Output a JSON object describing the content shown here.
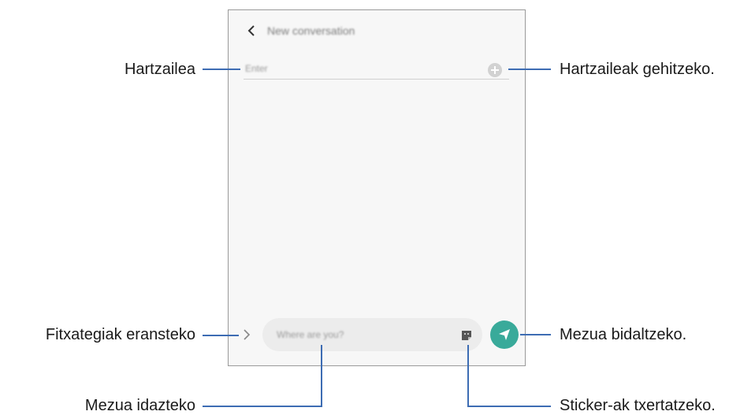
{
  "screen": {
    "title": "New conversation",
    "recipient_placeholder": "Enter",
    "message_placeholder": "Where are you?"
  },
  "callouts": {
    "recipient": "Hartzailea",
    "add_recipients": "Hartzaileak gehitzeko.",
    "attach_files": "Fitxategiak eransteko",
    "send_message": "Mezua bidaltzeko.",
    "compose_message": "Mezua idazteko",
    "insert_stickers": "Sticker-ak txertatzeko."
  },
  "colors": {
    "callout_line": "#3d6cb3",
    "send_button": "#39aa9a"
  },
  "icons": [
    "back-icon",
    "add-recipient-icon",
    "attach-icon",
    "sticker-icon",
    "send-icon"
  ]
}
